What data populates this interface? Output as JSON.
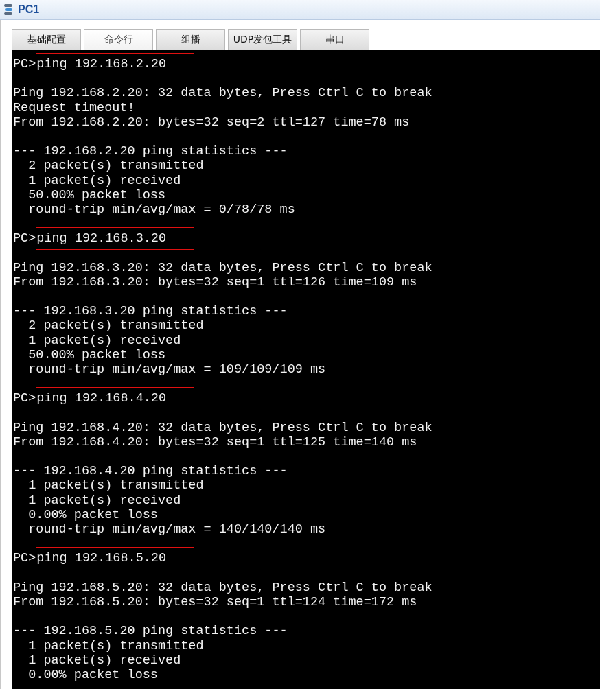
{
  "window": {
    "title": "PC1"
  },
  "tabs": [
    {
      "label": "基础配置",
      "selected": false
    },
    {
      "label": "命令行",
      "selected": true
    },
    {
      "label": "组播",
      "selected": false
    },
    {
      "label": "UDP发包工具",
      "selected": false
    },
    {
      "label": "串口",
      "selected": false
    }
  ],
  "terminal": {
    "lines": [
      {
        "kind": "command",
        "prompt": "PC>",
        "text": "ping 192.168.2.20",
        "highlighted": true
      },
      {
        "kind": "blank"
      },
      {
        "kind": "output",
        "text": "Ping 192.168.2.20: 32 data bytes, Press Ctrl_C to break"
      },
      {
        "kind": "output",
        "text": "Request timeout!"
      },
      {
        "kind": "output",
        "text": "From 192.168.2.20: bytes=32 seq=2 ttl=127 time=78 ms"
      },
      {
        "kind": "blank"
      },
      {
        "kind": "output",
        "text": "--- 192.168.2.20 ping statistics ---"
      },
      {
        "kind": "output",
        "text": "  2 packet(s) transmitted"
      },
      {
        "kind": "output",
        "text": "  1 packet(s) received"
      },
      {
        "kind": "output",
        "text": "  50.00% packet loss"
      },
      {
        "kind": "output",
        "text": "  round-trip min/avg/max = 0/78/78 ms"
      },
      {
        "kind": "blank"
      },
      {
        "kind": "command",
        "prompt": "PC>",
        "text": "ping 192.168.3.20",
        "highlighted": true
      },
      {
        "kind": "blank"
      },
      {
        "kind": "output",
        "text": "Ping 192.168.3.20: 32 data bytes, Press Ctrl_C to break"
      },
      {
        "kind": "output",
        "text": "From 192.168.3.20: bytes=32 seq=1 ttl=126 time=109 ms"
      },
      {
        "kind": "blank"
      },
      {
        "kind": "output",
        "text": "--- 192.168.3.20 ping statistics ---"
      },
      {
        "kind": "output",
        "text": "  2 packet(s) transmitted"
      },
      {
        "kind": "output",
        "text": "  1 packet(s) received"
      },
      {
        "kind": "output",
        "text": "  50.00% packet loss"
      },
      {
        "kind": "output",
        "text": "  round-trip min/avg/max = 109/109/109 ms"
      },
      {
        "kind": "blank"
      },
      {
        "kind": "command",
        "prompt": "PC>",
        "text": "ping 192.168.4.20",
        "highlighted": true
      },
      {
        "kind": "blank"
      },
      {
        "kind": "output",
        "text": "Ping 192.168.4.20: 32 data bytes, Press Ctrl_C to break"
      },
      {
        "kind": "output",
        "text": "From 192.168.4.20: bytes=32 seq=1 ttl=125 time=140 ms"
      },
      {
        "kind": "blank"
      },
      {
        "kind": "output",
        "text": "--- 192.168.4.20 ping statistics ---"
      },
      {
        "kind": "output",
        "text": "  1 packet(s) transmitted"
      },
      {
        "kind": "output",
        "text": "  1 packet(s) received"
      },
      {
        "kind": "output",
        "text": "  0.00% packet loss"
      },
      {
        "kind": "output",
        "text": "  round-trip min/avg/max = 140/140/140 ms"
      },
      {
        "kind": "blank"
      },
      {
        "kind": "command",
        "prompt": "PC>",
        "text": "ping 192.168.5.20",
        "highlighted": true
      },
      {
        "kind": "blank"
      },
      {
        "kind": "output",
        "text": "Ping 192.168.5.20: 32 data bytes, Press Ctrl_C to break"
      },
      {
        "kind": "output",
        "text": "From 192.168.5.20: bytes=32 seq=1 ttl=124 time=172 ms"
      },
      {
        "kind": "blank"
      },
      {
        "kind": "output",
        "text": "--- 192.168.5.20 ping statistics ---"
      },
      {
        "kind": "output",
        "text": "  1 packet(s) transmitted"
      },
      {
        "kind": "output",
        "text": "  1 packet(s) received"
      },
      {
        "kind": "output",
        "text": "  0.00% packet loss"
      }
    ]
  }
}
